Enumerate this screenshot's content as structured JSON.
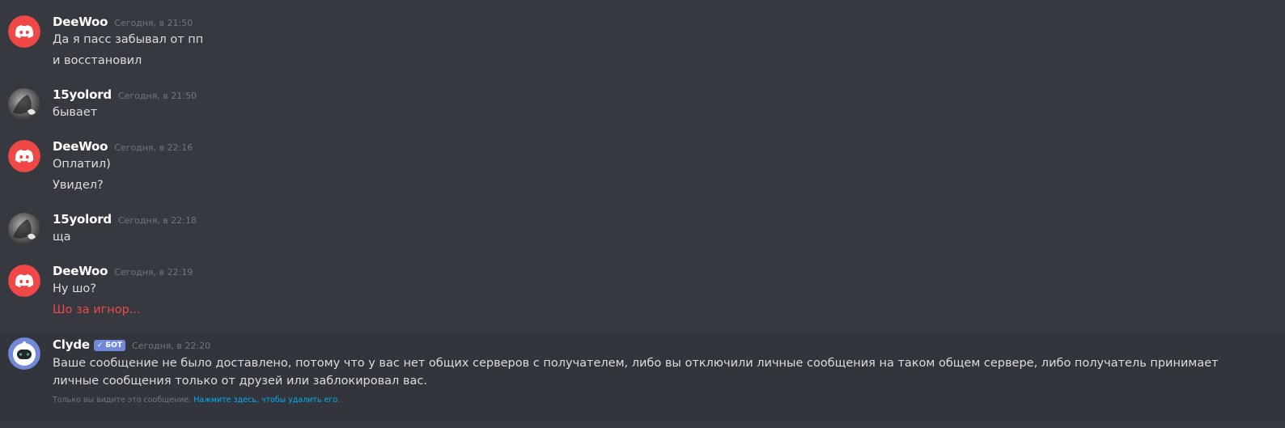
{
  "colors": {
    "background": "#36393f",
    "bot_background": "#32353b",
    "discord_red": "#f04747",
    "clyde_blue": "#7289da",
    "link": "#00b0f4"
  },
  "messages": [
    {
      "author": "DeeWoo",
      "avatar_icon": "discord-logo-icon",
      "timestamp": "Сегодня, в 21:50",
      "lines": [
        "Да я пасс забывал от пп",
        "и восстановил"
      ]
    },
    {
      "author": "15yolord",
      "avatar_icon": "user-photo-avatar",
      "timestamp": "Сегодня, в 21:50",
      "lines": [
        "бывает"
      ]
    },
    {
      "author": "DeeWoo",
      "avatar_icon": "discord-logo-icon",
      "timestamp": "Сегодня, в 22:16",
      "lines": [
        "Оплатил)",
        "Увидел?"
      ]
    },
    {
      "author": "15yolord",
      "avatar_icon": "user-photo-avatar",
      "timestamp": "Сегодня, в 22:18",
      "lines": [
        "ща"
      ]
    },
    {
      "author": "DeeWoo",
      "avatar_icon": "discord-logo-icon",
      "timestamp": "Сегодня, в 22:19",
      "lines": [
        "Ну шо?",
        "Шо за игнор..."
      ],
      "failed_line_index": 1
    }
  ],
  "bot_message": {
    "author": "Clyde",
    "avatar_icon": "clyde-robot-icon",
    "bot_tag": "БОТ",
    "timestamp": "Сегодня, в 22:20",
    "text": "Ваше сообщение не было доставлено, потому что у вас нет общих серверов с получателем, либо вы отключили личные сообщения на таком общем сервере, либо получатель принимает личные сообщения только от друзей или заблокировал вас.",
    "ephemeral_note": "Только вы видите это сообщение.",
    "dismiss_link": "Нажмите здесь, чтобы удалить его."
  }
}
